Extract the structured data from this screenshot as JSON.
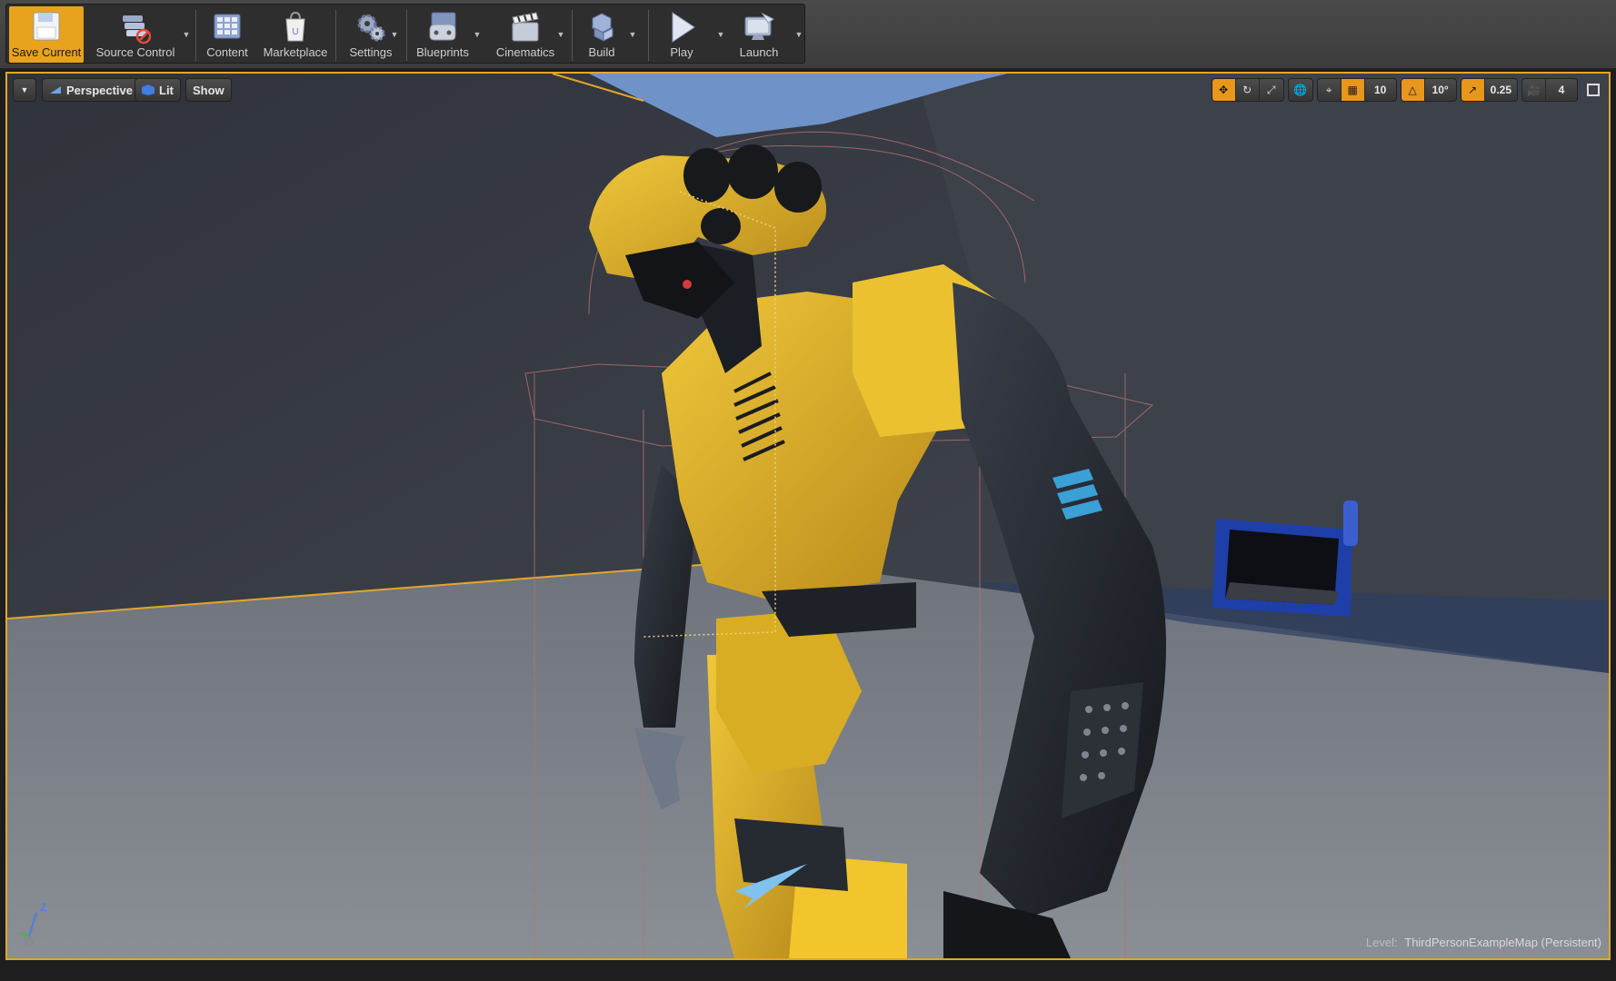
{
  "toolbar": {
    "buttons": [
      {
        "label": "Save Current",
        "icon": "floppy-disk-icon"
      },
      {
        "label": "Source Control",
        "icon": "source-control-icon"
      },
      {
        "label": "Content",
        "icon": "content-browser-icon"
      },
      {
        "label": "Marketplace",
        "icon": "marketplace-bag-icon"
      },
      {
        "label": "Settings",
        "icon": "settings-gears-icon"
      },
      {
        "label": "Blueprints",
        "icon": "blueprints-gamepad-icon"
      },
      {
        "label": "Cinematics",
        "icon": "clapperboard-icon"
      },
      {
        "label": "Build",
        "icon": "build-cubes-icon"
      },
      {
        "label": "Play",
        "icon": "play-icon"
      },
      {
        "label": "Launch",
        "icon": "launch-icon"
      }
    ]
  },
  "viewport": {
    "view_mode": "Perspective",
    "lighting_mode": "Lit",
    "show_label": "Show",
    "grid_snap": "10",
    "rotation_snap": "10°",
    "scale_snap": "0.25",
    "camera_speed": "4",
    "level_prefix": "Level:",
    "level_name": "ThirdPersonExampleMap (Persistent)",
    "axis_label": "Z"
  },
  "colors": {
    "accent": "#e8a21c",
    "selection_outline": "#e2a62a",
    "robot_yellow": "#e3b425",
    "robot_dark": "#23262d"
  }
}
